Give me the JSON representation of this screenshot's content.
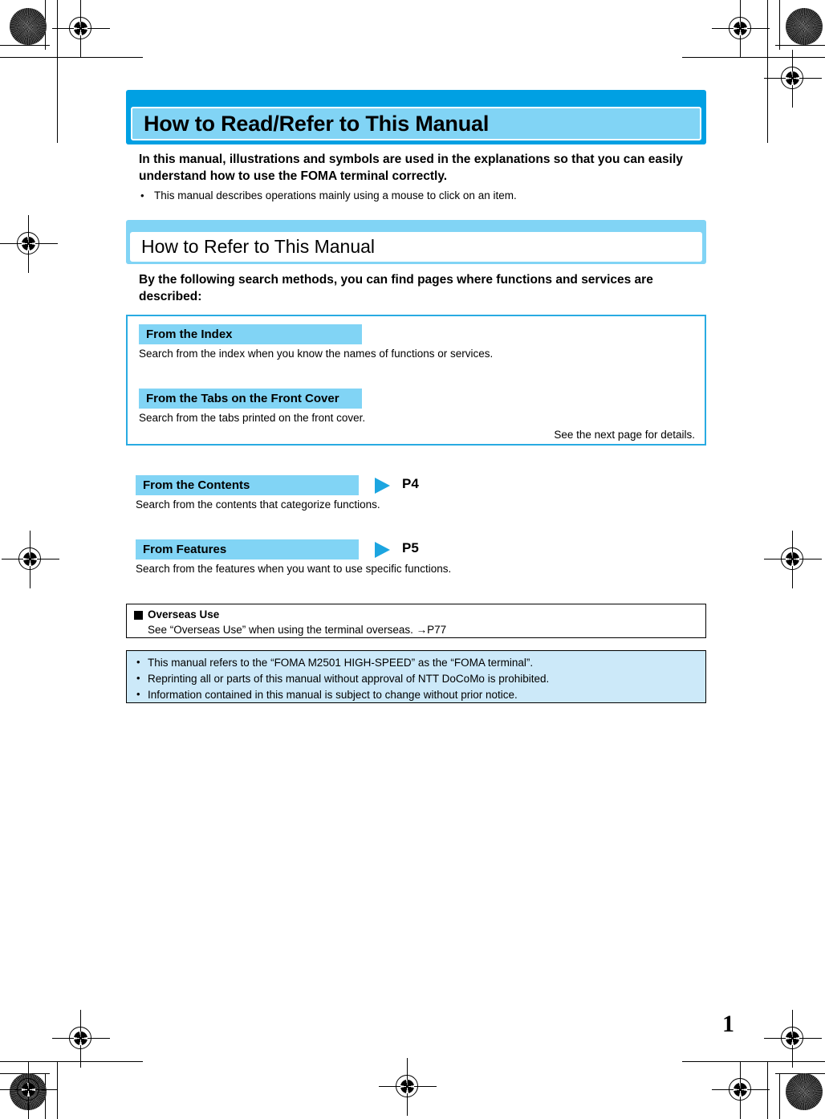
{
  "document": {
    "page_number": "1"
  },
  "chapter": {
    "title": "How to Read/Refer to This Manual",
    "lead": "In this manual, illustrations and symbols are used in the explanations so that you can easily understand how to use the FOMA terminal correctly.",
    "bullet_marker": "•",
    "bullet": "This manual describes operations mainly using a mouse to click on an item."
  },
  "section": {
    "title": "How to Refer to This Manual",
    "lead": "By the following search methods, you can find pages where functions and services are described:"
  },
  "method_box": {
    "items": [
      {
        "label": "From the Index",
        "description": "Search from the index when you know the names of functions or services."
      },
      {
        "label": "From the Tabs on the Front Cover",
        "description": "Search from the tabs printed on the front cover."
      }
    ],
    "note": "See the next page for details."
  },
  "method_rows": [
    {
      "label": "From the Contents",
      "page_ref": "P4",
      "description": "Search from the contents that categorize functions."
    },
    {
      "label": "From Features",
      "page_ref": "P5",
      "description": "Search from the features when you want to use specific functions."
    }
  ],
  "overseas": {
    "title": "Overseas Use",
    "description": "See “Overseas Use” when using the terminal overseas. →P77"
  },
  "notes": [
    "This manual refers to the “FOMA M2501 HIGH-SPEED” as the “FOMA terminal”.",
    "Reprinting all or parts of this manual without approval of NTT DoCoMo is prohibited.",
    "Information contained in this manual is subject to change without prior notice."
  ],
  "colors": {
    "chapter_bar": "#00A0E3",
    "chapter_inner": "#81D4F5",
    "section_bar": "#81D4F5",
    "method_label": "#81D4F5",
    "method_box_border": "#29ABE2",
    "arrow": "#1CA5E0",
    "notes_fill": "#CCE9F9"
  }
}
